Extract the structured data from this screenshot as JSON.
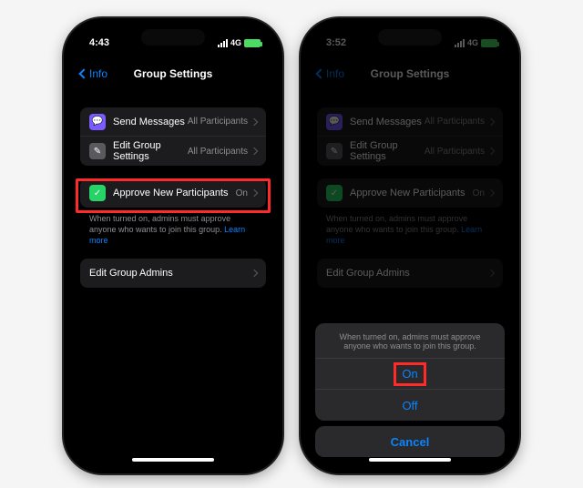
{
  "phone1": {
    "time": "4:43",
    "network": "4G",
    "battery": "100",
    "back_label": "Info",
    "title": "Group Settings",
    "sections": {
      "send_msgs": {
        "label": "Send Messages",
        "value": "All Participants"
      },
      "edit_settings": {
        "label": "Edit Group Settings",
        "value": "All Participants"
      },
      "approve": {
        "label": "Approve New Participants",
        "value": "On"
      },
      "edit_admins": {
        "label": "Edit Group Admins"
      }
    },
    "desc": "When turned on, admins must approve anyone who wants to join this group.",
    "learn_more": "Learn more"
  },
  "phone2": {
    "time": "3:52",
    "network": "4G",
    "battery": "100",
    "back_label": "Info",
    "title": "Group Settings",
    "sections": {
      "send_msgs": {
        "label": "Send Messages",
        "value": "All Participants"
      },
      "edit_settings": {
        "label": "Edit Group Settings",
        "value": "All Participants"
      },
      "approve": {
        "label": "Approve New Participants",
        "value": "On"
      },
      "edit_admins": {
        "label": "Edit Group Admins"
      }
    },
    "desc": "When turned on, admins must approve anyone who wants to join this group.",
    "learn_more": "Learn more",
    "sheet": {
      "desc": "When turned on, admins must approve anyone who wants to join this group.",
      "on": "On",
      "off": "Off",
      "cancel": "Cancel"
    }
  }
}
